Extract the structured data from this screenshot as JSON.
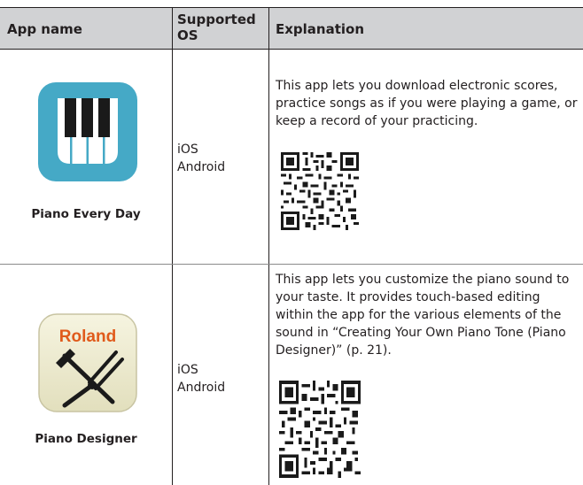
{
  "header": {
    "app_name": "App name",
    "supported_os_line1": "Supported",
    "supported_os_line2": "OS",
    "explanation": "Explanation"
  },
  "rows": [
    {
      "name": "Piano Every Day",
      "icon": "piano-keys-icon",
      "os_line1": "iOS",
      "os_line2": "Android",
      "explanation": "This app lets you download electronic scores, practice songs as if you were playing a game, or keep a record of your practicing.",
      "qr": "qr-code-icon"
    },
    {
      "name": "Piano Designer",
      "icon": "roland-tuning-tools-icon",
      "icon_text": "Roland",
      "os_line1": "iOS",
      "os_line2": "Android",
      "explanation": "This app lets you customize the piano sound to your taste. It provides touch-based editing within the app for the various elements of the sound in “Creating Your Own Piano Tone (Piano Designer)” (p. 21).",
      "qr": "qr-code-icon"
    }
  ],
  "colors": {
    "header_bg": "#d1d2d4",
    "piano_every_day_blue": "#45a9c6",
    "roland_orange": "#e05a1b",
    "designer_bg": "#efeccf"
  }
}
